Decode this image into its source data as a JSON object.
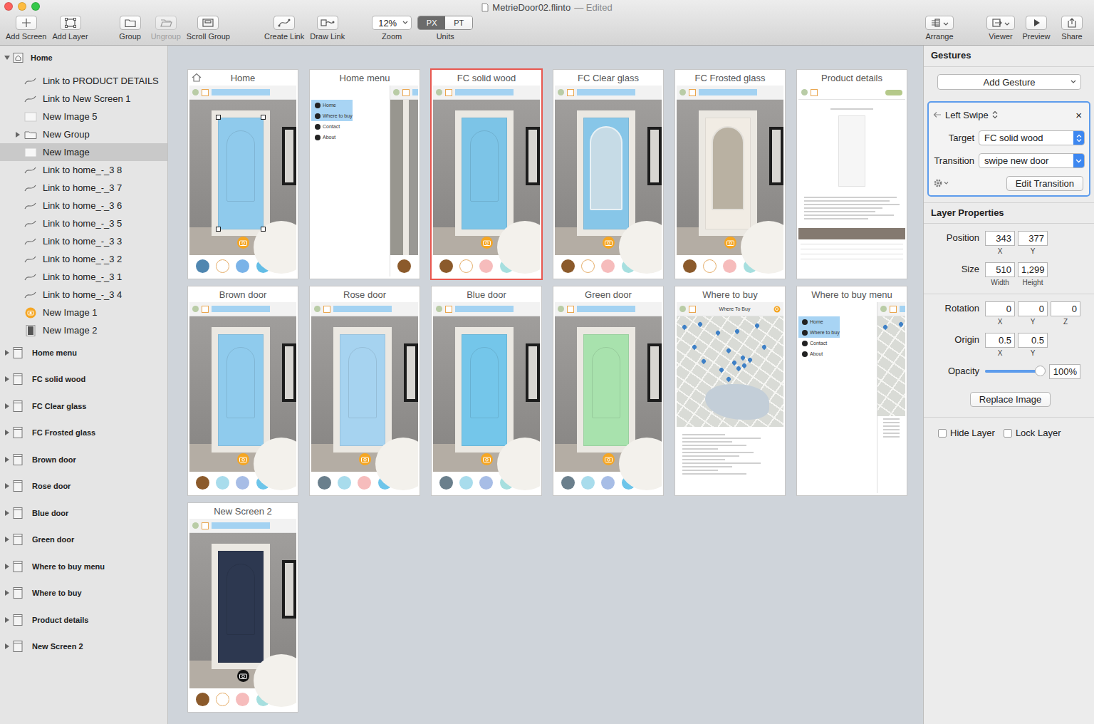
{
  "window": {
    "title": "MetrieDoor02.flinto",
    "status": "— Edited"
  },
  "toolbar": {
    "left_groups": [
      [
        {
          "label": "Add Screen",
          "disabled": false
        },
        {
          "label": "Add Layer",
          "disabled": false
        }
      ],
      [
        {
          "label": "Group",
          "disabled": false
        },
        {
          "label": "Ungroup",
          "disabled": true
        },
        {
          "label": "Scroll Group",
          "disabled": false
        }
      ],
      [
        {
          "label": "Create Link",
          "disabled": false
        },
        {
          "label": "Draw Link",
          "disabled": false
        }
      ]
    ],
    "zoom": {
      "label": "Zoom",
      "value": "12%"
    },
    "units": {
      "label": "Units",
      "options": [
        {
          "label": "PX",
          "selected": true
        },
        {
          "label": "PT",
          "selected": false
        }
      ]
    },
    "right_groups": [
      [
        {
          "label": "Arrange",
          "disabled": false
        }
      ],
      [
        {
          "label": "Viewer",
          "disabled": false
        },
        {
          "label": "Preview",
          "disabled": false
        },
        {
          "label": "Share",
          "disabled": false
        }
      ]
    ]
  },
  "sidebar": {
    "home": {
      "label": "Home",
      "expanded": true,
      "selected": false
    },
    "children": [
      {
        "label": "Link to PRODUCT DETAILS",
        "kind": "link",
        "selected": false
      },
      {
        "label": "Link to New Screen 1",
        "kind": "link",
        "selected": false
      },
      {
        "label": "New Image 5",
        "kind": "image",
        "selected": false
      },
      {
        "label": "New Group",
        "kind": "group",
        "expanded": false,
        "selected": false
      },
      {
        "label": "New Image",
        "kind": "image",
        "selected": true
      },
      {
        "label": "Link to home_-_3 8",
        "kind": "link",
        "selected": false
      },
      {
        "label": "Link to home_-_3 7",
        "kind": "link",
        "selected": false
      },
      {
        "label": "Link to home_-_3 6",
        "kind": "link",
        "selected": false
      },
      {
        "label": "Link to home_-_3 5",
        "kind": "link",
        "selected": false
      },
      {
        "label": "Link to home_-_3 3",
        "kind": "link",
        "selected": false
      },
      {
        "label": "Link to home_-_3 2",
        "kind": "link",
        "selected": false
      },
      {
        "label": "Link to home_-_3 1",
        "kind": "link",
        "selected": false
      },
      {
        "label": "Link to home_-_3 4",
        "kind": "link",
        "selected": false
      },
      {
        "label": "New Image 1",
        "kind": "badge",
        "selected": false
      },
      {
        "label": "New Image 2",
        "kind": "photo",
        "selected": false
      }
    ],
    "screens": [
      {
        "label": "Home menu",
        "expanded": false,
        "selected": false
      },
      {
        "label": "FC solid wood",
        "expanded": false,
        "selected": false
      },
      {
        "label": "FC Clear glass",
        "expanded": false,
        "selected": false
      },
      {
        "label": "FC Frosted glass",
        "expanded": false,
        "selected": false
      },
      {
        "label": "Brown door",
        "expanded": false,
        "selected": false
      },
      {
        "label": "Rose door",
        "expanded": false,
        "selected": false
      },
      {
        "label": "Blue door",
        "expanded": false,
        "selected": false
      },
      {
        "label": "Green door",
        "expanded": false,
        "selected": false
      },
      {
        "label": "Where to buy menu",
        "expanded": false,
        "selected": false
      },
      {
        "label": "Where to buy",
        "expanded": false,
        "selected": false
      },
      {
        "label": "Product details",
        "expanded": false,
        "selected": false
      },
      {
        "label": "New Screen 2",
        "expanded": false,
        "selected": false
      }
    ]
  },
  "canvas": {
    "screens": [
      {
        "title": "Home",
        "kind": "door",
        "home": true,
        "selected": false,
        "door": "#8fcaec",
        "handles": true,
        "camera": "#f5a623",
        "swatches": [
          {
            "color": "#4f86b0"
          },
          {
            "color": "#ffffff"
          },
          {
            "color": "#7ab3e8"
          },
          {
            "color": "#63bde6"
          },
          {
            "color": "#5fc1e9"
          }
        ]
      },
      {
        "title": "Home menu",
        "kind": "menu",
        "home": false,
        "selected": false,
        "menu": [
          {
            "label": "Home",
            "selected": true
          },
          {
            "label": "Where to buy",
            "selected": true
          },
          {
            "label": "Contact",
            "selected": false
          },
          {
            "label": "About",
            "selected": false
          }
        ],
        "swatches": [
          {
            "color": "#8b5a2b"
          }
        ]
      },
      {
        "title": "FC solid wood",
        "kind": "door",
        "home": false,
        "selected": true,
        "door": "#7cc4e7",
        "handles": false,
        "camera": "#f5a623",
        "swatches": [
          {
            "color": "#8b5a2b"
          },
          {
            "color": "#ffffff"
          },
          {
            "color": "#f6bcbc"
          },
          {
            "color": "#a6dfdf"
          },
          {
            "color": "#a6dfae"
          }
        ]
      },
      {
        "title": "FC Clear glass",
        "kind": "door",
        "home": false,
        "selected": false,
        "door": "#87c6e8",
        "glass": "#c6dbe6",
        "handles": false,
        "camera": "#f5a623",
        "swatches": [
          {
            "color": "#8b5a2b"
          },
          {
            "color": "#ffffff"
          },
          {
            "color": "#f6bcbc"
          },
          {
            "color": "#a6dfdf"
          },
          {
            "color": "#a6dfae"
          }
        ]
      },
      {
        "title": "FC Frosted glass",
        "kind": "door",
        "home": false,
        "selected": false,
        "door": "#f1ece4",
        "glass": "#b9b1a2",
        "handles": false,
        "camera": "#f5a623",
        "swatches": [
          {
            "color": "#8b5a2b"
          },
          {
            "color": "#ffffff"
          },
          {
            "color": "#f6bcbc"
          },
          {
            "color": "#a6dfdf"
          },
          {
            "color": "#a6dfae"
          }
        ]
      },
      {
        "title": "Product details",
        "kind": "details",
        "home": false,
        "selected": false
      },
      {
        "title": "Brown door",
        "kind": "door",
        "home": false,
        "selected": false,
        "door": "#8fcbed",
        "handles": false,
        "camera": "#f5a623",
        "swatches": [
          {
            "color": "#8b5a2b"
          },
          {
            "color": "#a8dcec"
          },
          {
            "color": "#a7bde6"
          },
          {
            "color": "#6dc5ea"
          },
          {
            "color": "#6ec6c9"
          }
        ]
      },
      {
        "title": "Rose door",
        "kind": "door",
        "home": false,
        "selected": false,
        "door": "#a6d3f0",
        "handles": false,
        "camera": "#f5a623",
        "swatches": [
          {
            "color": "#6a7f8c"
          },
          {
            "color": "#a8dcec"
          },
          {
            "color": "#f6bcbc"
          },
          {
            "color": "#6dc5ea"
          },
          {
            "color": "#a6dfae"
          }
        ]
      },
      {
        "title": "Blue door",
        "kind": "door",
        "home": false,
        "selected": false,
        "door": "#74c6ea",
        "handles": false,
        "camera": "#f5a623",
        "swatches": [
          {
            "color": "#6a7f8c"
          },
          {
            "color": "#a8dcec"
          },
          {
            "color": "#a7bde6"
          },
          {
            "color": "#a6dfdf"
          },
          {
            "color": "#5ec0cf"
          }
        ]
      },
      {
        "title": "Green door",
        "kind": "door",
        "home": false,
        "selected": false,
        "door": "#a8e2ad",
        "handles": false,
        "camera": "#f5a623",
        "swatches": [
          {
            "color": "#6a7f8c"
          },
          {
            "color": "#a8dcec"
          },
          {
            "color": "#a7bde6"
          },
          {
            "color": "#6dc5ea"
          },
          {
            "color": "#a6dfae"
          }
        ]
      },
      {
        "title": "Where to buy",
        "kind": "map",
        "home": false,
        "selected": false,
        "map_title": "Where To Buy"
      },
      {
        "title": "Where to buy menu",
        "kind": "menumap",
        "home": false,
        "selected": false,
        "menu": [
          {
            "label": "Home",
            "selected": true
          },
          {
            "label": "Where to buy",
            "selected": true
          },
          {
            "label": "Contact",
            "selected": false
          },
          {
            "label": "About",
            "selected": false
          }
        ]
      },
      {
        "title": "New Screen 2",
        "kind": "door",
        "home": false,
        "selected": false,
        "door": "#2d3850",
        "handles": false,
        "camera": "#111111",
        "swatches": [
          {
            "color": "#8b5a2b"
          },
          {
            "color": "#ffffff"
          },
          {
            "color": "#f6bcbc"
          },
          {
            "color": "#a6dfdf"
          },
          {
            "color": "#a6dfae"
          }
        ]
      }
    ]
  },
  "inspector": {
    "gestures": {
      "title": "Gestures",
      "add": "Add Gesture",
      "gesture": {
        "name": "Left Swipe",
        "close": "×",
        "fields": [
          {
            "label": "Target",
            "value": "FC solid wood",
            "kind": "stepper"
          },
          {
            "label": "Transition",
            "value": "swipe new door",
            "kind": "dropdown"
          }
        ],
        "edit": "Edit Transition"
      }
    },
    "layer": {
      "title": "Layer Properties",
      "groups": [
        [
          {
            "label": "Position",
            "fields": [
              {
                "value": "343",
                "caption": "X"
              },
              {
                "value": "377",
                "caption": "Y"
              }
            ]
          },
          {
            "label": "Size",
            "fields": [
              {
                "value": "510",
                "caption": "Width"
              },
              {
                "value": "1,299",
                "caption": "Height"
              }
            ]
          }
        ],
        [
          {
            "label": "Rotation",
            "fields": [
              {
                "value": "0",
                "caption": "X"
              },
              {
                "value": "0",
                "caption": "Y"
              },
              {
                "value": "0",
                "caption": "Z"
              }
            ]
          },
          {
            "label": "Origin",
            "fields": [
              {
                "value": "0.5",
                "caption": "X"
              },
              {
                "value": "0.5",
                "caption": "Y"
              }
            ]
          }
        ]
      ],
      "opacity": {
        "label": "Opacity",
        "level": 1,
        "value": "100%"
      },
      "replace": "Replace Image",
      "checkboxes": [
        {
          "label": "Hide Layer",
          "checked": false
        },
        {
          "label": "Lock Layer",
          "checked": false
        }
      ]
    }
  }
}
